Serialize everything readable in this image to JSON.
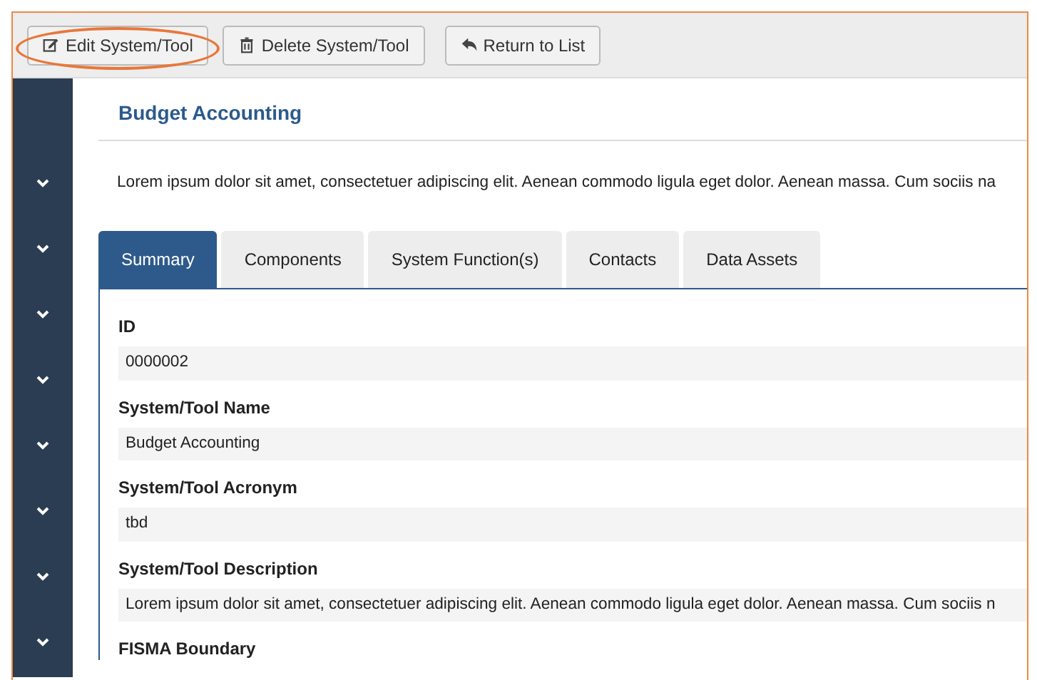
{
  "toolbar": {
    "buttons": [
      {
        "label": "Edit System/Tool",
        "kind": "edit",
        "highlighted": true
      },
      {
        "label": "Delete System/Tool",
        "kind": "delete",
        "highlighted": false
      },
      {
        "label": "Return to List",
        "kind": "return",
        "highlighted": false
      }
    ]
  },
  "page": {
    "title": "Budget Accounting",
    "description": "Lorem ipsum dolor sit amet, consectetuer adipiscing elit. Aenean commodo ligula eget dolor. Aenean massa. Cum sociis na"
  },
  "tabs": [
    {
      "label": "Summary",
      "selected": true
    },
    {
      "label": "Components",
      "selected": false
    },
    {
      "label": "System Function(s)",
      "selected": false
    },
    {
      "label": "Contacts",
      "selected": false
    },
    {
      "label": "Data Assets",
      "selected": false
    }
  ],
  "fields": [
    {
      "label": "ID",
      "value": "0000002"
    },
    {
      "label": "System/Tool Name",
      "value": "Budget Accounting"
    },
    {
      "label": "System/Tool Acronym",
      "value": "tbd"
    },
    {
      "label": "System/Tool Description",
      "value": "Lorem ipsum dolor sit amet, consectetuer adipiscing elit. Aenean commodo ligula eget dolor. Aenean massa. Cum sociis n"
    },
    {
      "label": "FISMA Boundary"
    }
  ]
}
